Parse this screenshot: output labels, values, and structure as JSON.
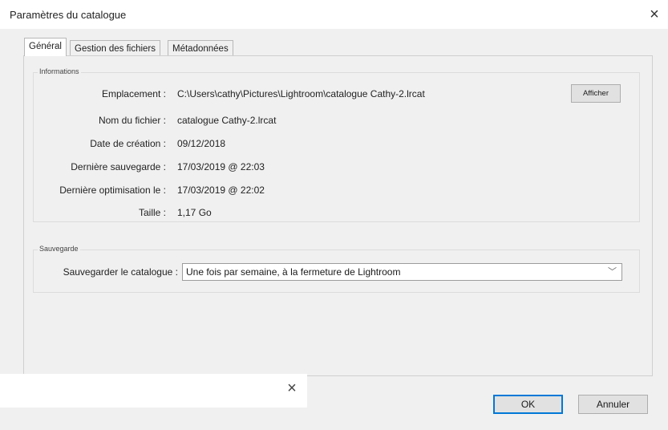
{
  "window": {
    "title": "Paramètres du catalogue",
    "close_icon": "×"
  },
  "tabs": [
    {
      "label": "Général",
      "active": true
    },
    {
      "label": "Gestion des fichiers",
      "active": false
    },
    {
      "label": "Métadonnées",
      "active": false
    }
  ],
  "informations": {
    "title": "Informations",
    "rows": [
      {
        "label": "Emplacement :",
        "value": "C:\\Users\\cathy\\Pictures\\Lightroom\\catalogue Cathy-2.lrcat"
      },
      {
        "label": "Nom du fichier :",
        "value": "catalogue Cathy-2.lrcat"
      },
      {
        "label": "Date de création :",
        "value": "09/12/2018"
      },
      {
        "label": "Dernière sauvegarde :",
        "value": "17/03/2019 @ 22:03"
      },
      {
        "label": "Dernière optimisation le :",
        "value": "17/03/2019 @ 22:02"
      },
      {
        "label": "Taille :",
        "value": "1,17 Go"
      }
    ],
    "show_button": "Afficher"
  },
  "sauvegarde": {
    "title": "Sauvegarde",
    "label": "Sauvegarder le catalogue :",
    "selected": "Une fois par semaine, à la fermeture de Lightroom",
    "chevron_icon": "﹀"
  },
  "buttons": {
    "ok": "OK",
    "cancel": "Annuler"
  },
  "overlay": {
    "close_icon": "×"
  },
  "colors": {
    "background": "#f0f0f0",
    "focus_border": "#0078d7"
  }
}
